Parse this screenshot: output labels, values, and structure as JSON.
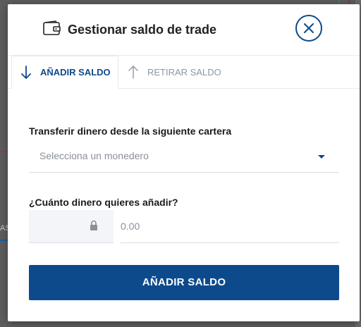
{
  "modal": {
    "title": "Gestionar saldo de trade",
    "icon": "wallet-icon",
    "close_icon": "close-icon"
  },
  "tabs": [
    {
      "label": "AÑADIR SALDO",
      "icon": "arrow-down-icon",
      "active": true
    },
    {
      "label": "RETIRAR SALDO",
      "icon": "arrow-up-icon",
      "active": false
    }
  ],
  "form": {
    "wallet_label": "Transferir dinero desde la siguiente cartera",
    "wallet_select_placeholder": "Selecciona un monedero",
    "amount_label": "¿Cuánto dinero quieres añadir?",
    "amount_placeholder": "0.00",
    "currency_icon": "lock-icon",
    "submit_label": "AÑADIR SALDO"
  },
  "background": {
    "left_tab_fragment": "AS"
  },
  "colors": {
    "primary": "#0d4a8c",
    "muted_text": "#8a8f98",
    "overlay": "#5d5d5d",
    "border": "#e6e9ee"
  }
}
